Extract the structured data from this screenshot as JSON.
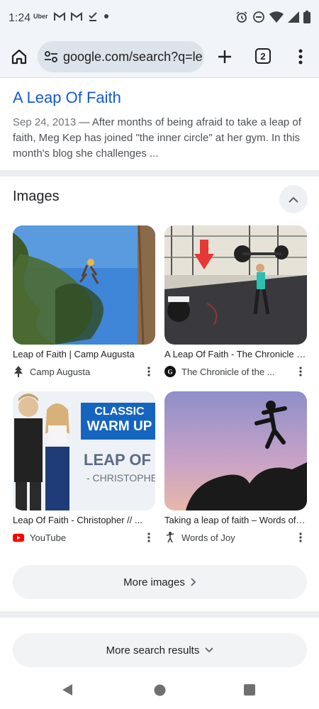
{
  "status_bar": {
    "time": "1:24",
    "uber": "Uber",
    "icons_left": [
      "gmail-icon",
      "gmail-icon",
      "download-done-icon",
      "dot-icon"
    ],
    "icons_right": [
      "alarm-icon",
      "dnd-icon",
      "wifi-icon",
      "signal-icon",
      "battery-icon"
    ]
  },
  "toolbar": {
    "url": "google.com/search?q=le",
    "tab_count": "2"
  },
  "result": {
    "title": "A Leap Of Faith",
    "date": "Sep 24, 2013",
    "snippet": " — After months of being afraid to take a leap of faith, Meg Kep has joined \"the inner circle\" at her gym. In this month's blog she challenges ..."
  },
  "images_section": {
    "header": "Images",
    "items": [
      {
        "title": "Leap of Faith | Camp Augusta",
        "source": "Camp Augusta",
        "source_icon": "tree-icon"
      },
      {
        "title": "A Leap Of Faith - The Chronicle of the ...",
        "source": "The Chronicle of the ...",
        "source_icon": "chronicle-logo-icon"
      },
      {
        "title": "Leap Of Faith - Christopher // ...",
        "source": "YouTube",
        "source_icon": "youtube-icon"
      },
      {
        "title": "Taking a leap of faith – Words of Joy",
        "source": "Words of Joy",
        "source_icon": "dancer-icon"
      }
    ],
    "thumb_texts": {
      "classic": "CLASSIC",
      "warm_up": "WARM UP",
      "leap_of_fa": "LEAP OF FA",
      "christopher": "- CHRISTOPHER"
    },
    "more_images": "More images"
  },
  "more_results": "More search results",
  "colors": {
    "link": "#1558d6",
    "chrome_bg": "#f1f4f9",
    "omnibox": "#dde3ea"
  }
}
